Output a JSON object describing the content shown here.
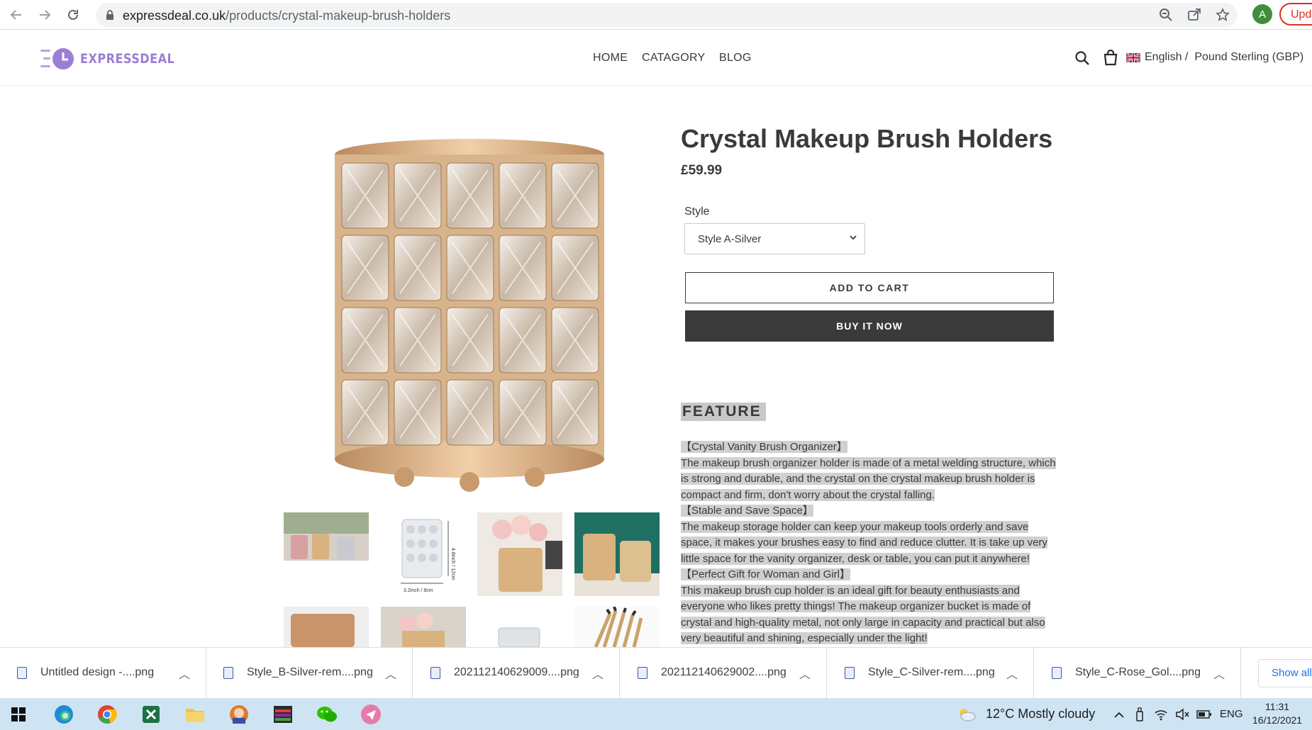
{
  "browser": {
    "url_domain": "expressdeal.co.uk",
    "url_path": "/products/crystal-makeup-brush-holders",
    "profile_initial": "A",
    "update_label": "Upda"
  },
  "store": {
    "logo_text": "EXPRESSDEAL",
    "nav": [
      "HOME",
      "CATAGORY",
      "BLOG"
    ],
    "language": "English /",
    "currency": "Pound Sterling (GBP)"
  },
  "product": {
    "title": "Crystal Makeup Brush Holders",
    "price": "£59.99",
    "style_label": "Style",
    "style_value": "Style A-Silver",
    "add_to_cart": "ADD TO CART",
    "buy_now": "BUY IT NOW",
    "feature_heading": "FEATURE",
    "description_lines": [
      "【Crystal Vanity Brush Organizer】",
      "The makeup brush organizer holder is made of a metal welding structure, which",
      "is strong and durable, and the crystal on the crystal makeup brush holder is",
      "compact and firm, don't worry about the crystal falling.",
      "【Stable and Save Space】",
      "The makeup storage holder can keep your makeup tools orderly and save",
      "space, it makes your brushes easy to find and reduce clutter. It is take up very",
      "little space for the vanity organizer, desk or table, you can put it anywhere!",
      "【Perfect Gift for Woman and Girl】",
      "This makeup brush cup holder is an ideal gift for beauty enthusiasts and",
      "everyone who likes pretty things! The makeup organizer bucket is made of",
      "crystal and high-quality metal, not only large in capacity and practical but also",
      "very beautiful and shining, especially under the light!"
    ],
    "thumbnail_dimension_labels": [
      "4.8inch / 12cm",
      "3.2inch / 8cm"
    ]
  },
  "downloads": {
    "items": [
      "Untitled design -....png",
      "Style_B-Silver-rem....png",
      "202112140629009....png",
      "202112140629002....png",
      "Style_C-Silver-rem....png",
      "Style_C-Rose_Gol....png"
    ],
    "show_all": "Show all"
  },
  "taskbar": {
    "weather": "12°C  Mostly cloudy",
    "language": "ENG",
    "time": "11:31",
    "date": "16/12/2021"
  },
  "colors": {
    "brand": "#9b7fd3",
    "button_dark": "#3a3a3a",
    "gold": "#d9a778",
    "highlight": "#d0d0d0"
  }
}
